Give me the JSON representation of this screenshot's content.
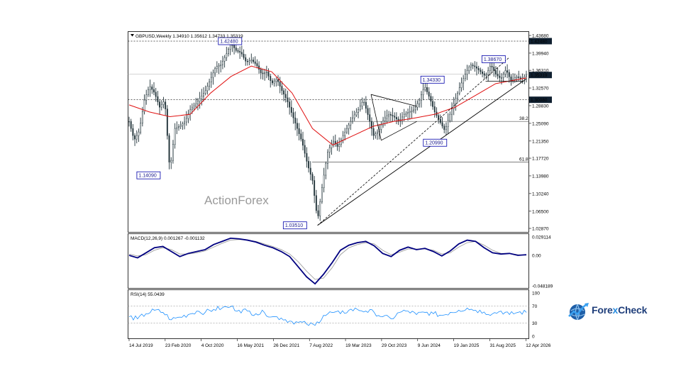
{
  "chart_data": [
    {
      "type": "candlestick",
      "panel": "price",
      "symbol_header": "GBPUSD,Weekly  1.34910 1.35612 1.34733 1.35319",
      "ylim": [
        1.0287,
        1.4368
      ],
      "y_ticks": [
        "1.43680",
        "1.39940",
        "1.36310",
        "1.32570",
        "1.28830",
        "1.25090",
        "1.21350",
        "1.17720",
        "1.13980",
        "1.10240",
        "1.06500",
        "1.02870"
      ],
      "right_tags": [
        {
          "label": "1.42480",
          "value": 1.4248,
          "style": "dark"
        },
        {
          "label": "1.35319",
          "value": 1.35319,
          "style": "dark"
        },
        {
          "label": "1.30080",
          "value": 1.3008,
          "style": "dark"
        }
      ],
      "horizontal_levels": [
        {
          "value": 1.4248,
          "style": "dotted"
        },
        {
          "value": 1.3008,
          "style": "dotted"
        },
        {
          "value": 1.3553,
          "style": "solid-gray"
        },
        {
          "value": 1.255,
          "label": "38.2",
          "style": "solid"
        },
        {
          "value": 1.169,
          "label": "61.8",
          "style": "solid"
        }
      ],
      "annotations": [
        "1.42480",
        "1.38670",
        "1.34330",
        "1.14090",
        "1.20990",
        "1.03510"
      ],
      "watermark": "ActionForex",
      "x_labels": [
        "14 Jul 2019",
        "23 Feb 2020",
        "4 Oct 2020",
        "16 May 2021",
        "26 Dec 2021",
        "7 Aug 2022",
        "19 Mar 2023",
        "29 Oct 2023",
        "9 Jun 2024",
        "19 Jan 2025",
        "31 Aug 2025",
        "12 Apr 2026"
      ],
      "price_path": [
        [
          0,
          1.255
        ],
        [
          4,
          1.215
        ],
        [
          8,
          1.235
        ],
        [
          12,
          1.3
        ],
        [
          16,
          1.33
        ],
        [
          20,
          1.315
        ],
        [
          24,
          1.285
        ],
        [
          28,
          1.3
        ],
        [
          32,
          1.15
        ],
        [
          36,
          1.24
        ],
        [
          40,
          1.245
        ],
        [
          44,
          1.255
        ],
        [
          48,
          1.28
        ],
        [
          52,
          1.29
        ],
        [
          56,
          1.305
        ],
        [
          60,
          1.32
        ],
        [
          64,
          1.345
        ],
        [
          68,
          1.37
        ],
        [
          72,
          1.375
        ],
        [
          76,
          1.395
        ],
        [
          80,
          1.42
        ],
        [
          84,
          1.405
        ],
        [
          88,
          1.4
        ],
        [
          92,
          1.38
        ],
        [
          96,
          1.385
        ],
        [
          100,
          1.375
        ],
        [
          104,
          1.355
        ],
        [
          108,
          1.36
        ],
        [
          112,
          1.335
        ],
        [
          116,
          1.345
        ],
        [
          120,
          1.32
        ],
        [
          124,
          1.3
        ],
        [
          128,
          1.27
        ],
        [
          132,
          1.24
        ],
        [
          136,
          1.21
        ],
        [
          140,
          1.165
        ],
        [
          144,
          1.13
        ],
        [
          148,
          1.045
        ],
        [
          152,
          1.125
        ],
        [
          156,
          1.19
        ],
        [
          160,
          1.215
        ],
        [
          164,
          1.2
        ],
        [
          168,
          1.225
        ],
        [
          172,
          1.245
        ],
        [
          176,
          1.265
        ],
        [
          180,
          1.28
        ],
        [
          184,
          1.3
        ],
        [
          188,
          1.265
        ],
        [
          192,
          1.225
        ],
        [
          196,
          1.235
        ],
        [
          200,
          1.26
        ],
        [
          204,
          1.27
        ],
        [
          208,
          1.265
        ],
        [
          212,
          1.255
        ],
        [
          216,
          1.27
        ],
        [
          220,
          1.275
        ],
        [
          224,
          1.28
        ],
        [
          228,
          1.3
        ],
        [
          232,
          1.33
        ],
        [
          236,
          1.305
        ],
        [
          240,
          1.275
        ],
        [
          244,
          1.255
        ],
        [
          248,
          1.235
        ],
        [
          252,
          1.27
        ],
        [
          256,
          1.3
        ],
        [
          260,
          1.33
        ],
        [
          264,
          1.355
        ],
        [
          268,
          1.375
        ],
        [
          272,
          1.37
        ],
        [
          276,
          1.36
        ],
        [
          280,
          1.35
        ],
        [
          284,
          1.375
        ],
        [
          288,
          1.355
        ],
        [
          292,
          1.345
        ],
        [
          296,
          1.365
        ],
        [
          300,
          1.34
        ],
        [
          304,
          1.35
        ],
        [
          308,
          1.345
        ],
        [
          312,
          1.353
        ]
      ],
      "ma_path": [
        [
          0,
          1.29
        ],
        [
          16,
          1.275
        ],
        [
          32,
          1.265
        ],
        [
          48,
          1.27
        ],
        [
          64,
          1.315
        ],
        [
          80,
          1.35
        ],
        [
          96,
          1.372
        ],
        [
          112,
          1.36
        ],
        [
          128,
          1.315
        ],
        [
          144,
          1.24
        ],
        [
          160,
          1.205
        ],
        [
          176,
          1.225
        ],
        [
          192,
          1.245
        ],
        [
          208,
          1.255
        ],
        [
          224,
          1.262
        ],
        [
          240,
          1.27
        ],
        [
          256,
          1.285
        ],
        [
          272,
          1.31
        ],
        [
          288,
          1.335
        ],
        [
          312,
          1.347
        ]
      ]
    },
    {
      "type": "line",
      "panel": "macd",
      "header": "MACD(12,26,9) 0.001267 -0.001132",
      "y_ticks": [
        "0.029114",
        "0.00",
        "-0.048189"
      ],
      "ylim": [
        -0.048189,
        0.029114
      ],
      "series": [
        {
          "name": "MACD",
          "color": "#000080",
          "values": [
            0.0,
            -0.004,
            0.004,
            0.012,
            0.014,
            0.006,
            -0.002,
            0.003,
            0.006,
            0.009,
            0.017,
            0.022,
            0.027,
            0.026,
            0.024,
            0.021,
            0.016,
            0.012,
            0.006,
            -0.002,
            -0.018,
            -0.034,
            -0.045,
            -0.03,
            -0.012,
            0.008,
            0.016,
            0.02,
            0.022,
            0.015,
            0.003,
            -0.002,
            0.008,
            0.013,
            0.009,
            0.011,
            0.006,
            -0.001,
            0.007,
            0.018,
            0.024,
            0.022,
            0.012,
            0.004,
            0.002,
            0.003,
            0.0,
            0.001
          ]
        },
        {
          "name": "Signal",
          "color": "#a0a0a0",
          "values": [
            0.002,
            -0.001,
            0.001,
            0.008,
            0.012,
            0.009,
            0.002,
            0.002,
            0.004,
            0.007,
            0.013,
            0.019,
            0.024,
            0.025,
            0.024,
            0.022,
            0.018,
            0.014,
            0.009,
            0.002,
            -0.01,
            -0.025,
            -0.038,
            -0.036,
            -0.02,
            0.001,
            0.012,
            0.017,
            0.02,
            0.018,
            0.008,
            0.001,
            0.005,
            0.01,
            0.01,
            0.01,
            0.008,
            0.002,
            0.004,
            0.013,
            0.02,
            0.022,
            0.016,
            0.008,
            0.003,
            0.003,
            0.001,
            0.0
          ]
        }
      ]
    },
    {
      "type": "line",
      "panel": "rsi",
      "header": "RSI(14) 55.0439",
      "y_ticks": [
        "100",
        "70",
        "30",
        "0"
      ],
      "ylim": [
        0,
        100
      ],
      "levels": [
        70,
        30
      ],
      "series": [
        {
          "name": "RSI",
          "color": "#1e90ff",
          "values": [
            45,
            40,
            52,
            60,
            55,
            38,
            44,
            50,
            58,
            55,
            62,
            65,
            68,
            60,
            58,
            52,
            55,
            45,
            42,
            35,
            32,
            28,
            25,
            48,
            55,
            52,
            60,
            62,
            58,
            55,
            45,
            40,
            55,
            58,
            50,
            55,
            52,
            48,
            55,
            60,
            65,
            60,
            56,
            52,
            58,
            50,
            55,
            55
          ]
        }
      ]
    }
  ],
  "brand": {
    "name_part1": "Fore",
    "name_x": "x",
    "name_part2": "Check"
  }
}
